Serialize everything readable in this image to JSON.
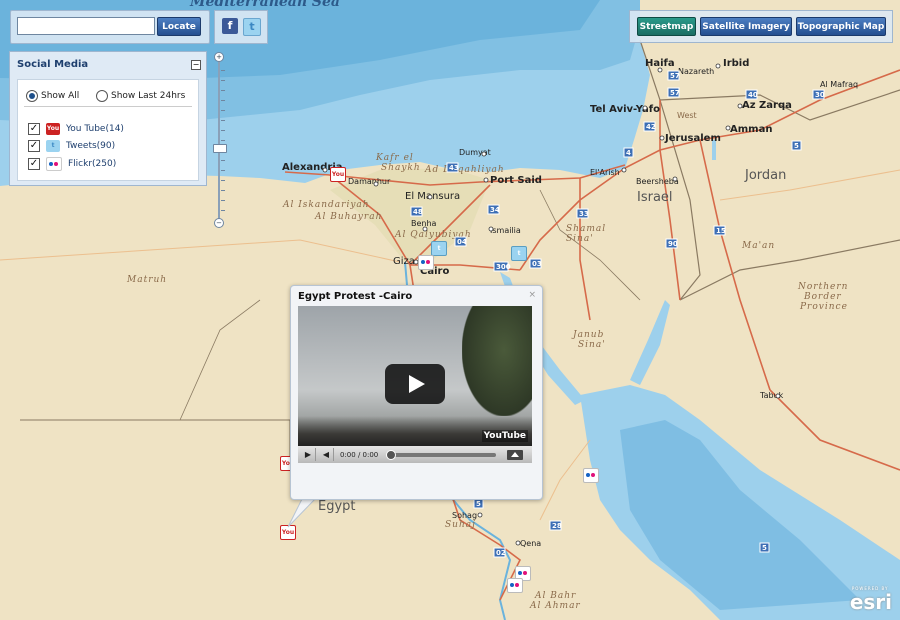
{
  "search": {
    "input_value": "",
    "placeholder": "",
    "locate_label": "Locate"
  },
  "share": {
    "facebook_label": "f",
    "twitter_label": "t"
  },
  "basemaps": {
    "streetmap": "Streetmap",
    "satellite": "Satellite Imagery",
    "topographic": "Topographic Map"
  },
  "social_panel": {
    "title": "Social Media",
    "collapse_symbol": "−",
    "filter_all": "Show All",
    "filter_24": "Show Last 24hrs",
    "selected_filter": "Show All",
    "layers": [
      {
        "label": "You Tube(14)",
        "checked": true,
        "icon": "youtube-icon"
      },
      {
        "label": "Tweets(90)",
        "checked": true,
        "icon": "twitter-icon"
      },
      {
        "label": "Flickr(250)",
        "checked": true,
        "icon": "flickr-icon"
      }
    ],
    "check_mark": "✓"
  },
  "zoom": {
    "plus": "+",
    "minus": "−",
    "level_fraction": 0.55
  },
  "popup": {
    "title": "Egypt Protest -Cairo",
    "close_symbol": "×",
    "youtube_badge": "YouTube",
    "time": "0:00 / 0:00",
    "play_symbol": "▶",
    "volume_symbol": "◀"
  },
  "map": {
    "sea": "Mediterranean Sea",
    "countries": {
      "egypt": "Egypt",
      "israel": "Israel",
      "jordan": "Jordan"
    },
    "places": {
      "haifa": "Haifa",
      "nazareth": "Nazareth",
      "irbid": "Irbid",
      "telaviv": "Tel Aviv-Yafo",
      "azzarqa": "Az Zarqa",
      "almafraq": "Al Mafraq",
      "amman": "Amman",
      "jerusalem": "Jerusalem",
      "alexandria": "Alexandria",
      "dumyat": "Dumyat",
      "portsaid": "Port Said",
      "alarish": "El'Arish",
      "beersheba": "Beersheba",
      "damanhur": "Damanhur",
      "elmansura": "El Mansura",
      "benha": "Benha",
      "ismailia": "Ismailia",
      "giza": "Giza",
      "cairo": "Cairo",
      "tabuk": "Tabuk",
      "sohag": "Sohag",
      "qena": "Qena",
      "west": "West"
    },
    "regions": {
      "kafr": "Kafr el",
      "shaykh": "Shaykh",
      "dakahliya": "Ad Daqahliyah",
      "qalyubiya": "Al Qalyubiyah",
      "alexandriya": "Al Iskandariyah",
      "buhayra": "Al Buhayrah",
      "matruh": "Matruh",
      "shamal": "Shamal",
      "sina": "Sina'",
      "janub": "Janub",
      "sinai2": "Sina'",
      "maan": "Ma'an",
      "northern": "Northern",
      "border": "Border",
      "province": "Province",
      "suhaj": "Suhaj",
      "albahr": "Al Bahr",
      "alahmar": "Al Ahmar"
    },
    "shields": {
      "s1": "57",
      "s2": "57",
      "s3": "40",
      "s4": "42",
      "s5": "30",
      "s6": "4",
      "s7": "43",
      "s8": "5",
      "s9": "34",
      "s10": "48",
      "s11": "33",
      "s12": "04",
      "s13": "300",
      "s14": "03",
      "s15": "90",
      "s16": "15",
      "s17": "5",
      "s18": "28",
      "s19": "02",
      "s20": "5"
    }
  },
  "markers": {
    "youtube": "You",
    "twitter": "t",
    "flickr": ""
  },
  "attribution": {
    "powered": "POWERED BY",
    "brand": "esri"
  },
  "colors": {
    "land": "#efe3c4",
    "sea": "#9dd0ec",
    "deep_sea": "#6ab3dd",
    "road": "#d66a4a",
    "accent_blue": "#244f8f"
  }
}
